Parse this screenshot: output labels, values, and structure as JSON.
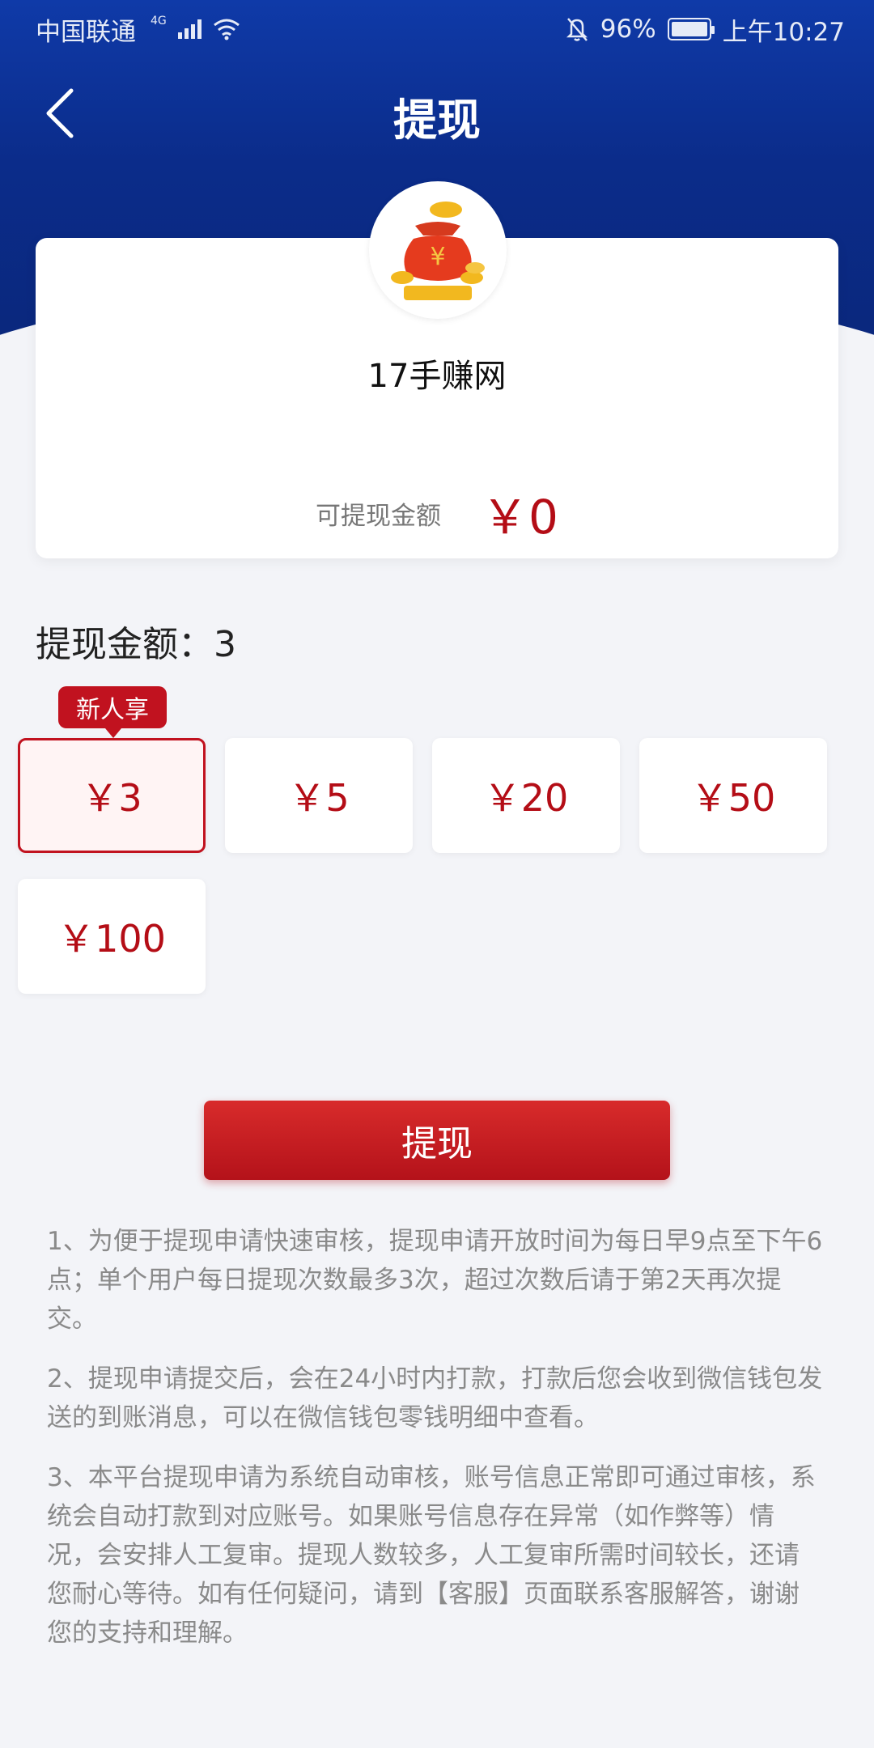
{
  "status_bar": {
    "carrier": "中国联通",
    "network": "4G",
    "battery": "96%",
    "time": "上午10:27"
  },
  "nav": {
    "title": "提现"
  },
  "app": {
    "name": "17手赚网",
    "balance_label": "可提现金额",
    "balance_value": "￥0"
  },
  "amount": {
    "label": "提现金额：3"
  },
  "badge": "新人享",
  "options": [
    "￥3",
    "￥5",
    "￥20",
    "￥50",
    "￥100"
  ],
  "button": {
    "label": "提现"
  },
  "notes": [
    "1、为便于提现申请快速审核，提现申请开放时间为每日早9点至下午6点；单个用户每日提现次数最多3次，超过次数后请于第2天再次提交。",
    "2、提现申请提交后，会在24小时内打款，打款后您会收到微信钱包发送的到账消息，可以在微信钱包零钱明细中查看。",
    "3、本平台提现申请为系统自动审核，账号信息正常即可通过审核，系统会自动打款到对应账号。如果账号信息存在异常（如作弊等）情况，会安排人工复审。提现人数较多，人工复审所需时间较长，还请您耐心等待。如有任何疑问，请到【客服】页面联系客服解答，谢谢您的支持和理解。"
  ],
  "colors": {
    "header": "#0b2c8a",
    "accent": "#c1121f"
  }
}
